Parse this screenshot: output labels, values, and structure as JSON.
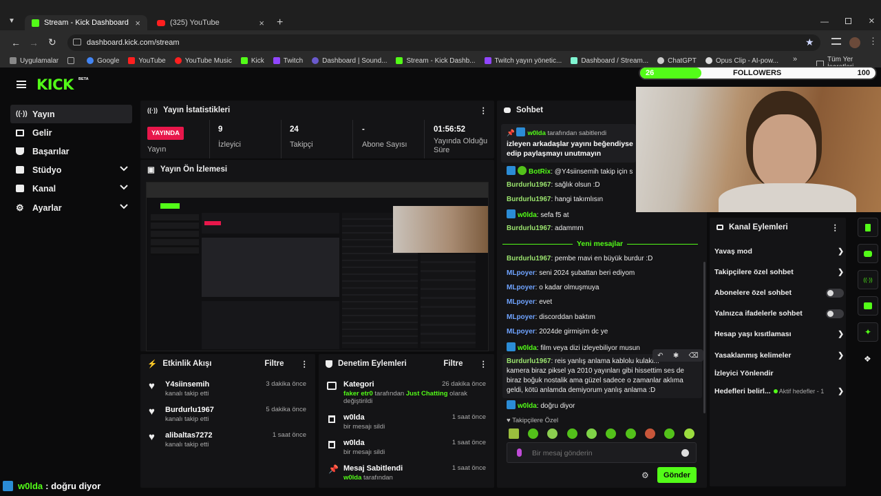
{
  "browser": {
    "tabs": [
      {
        "title": "Stream - Kick Dashboard",
        "active": true
      },
      {
        "title": "(325) YouTube",
        "active": false
      }
    ],
    "url": "dashboard.kick.com/stream",
    "bookmarks": [
      "Uygulamalar",
      "Google",
      "YouTube",
      "YouTube Music",
      "Kick",
      "Twitch",
      "Dashboard | Sound...",
      "Stream - Kick Dashb...",
      "Twitch yayın yönetic...",
      "Dashboard / Stream...",
      "ChatGPT",
      "Opus Clip - AI-pow..."
    ],
    "all_bookmarks": "Tüm Yer İşaretleri"
  },
  "brand": {
    "logo": "KICK",
    "badge": "BETA"
  },
  "sidebar": {
    "items": [
      {
        "label": "Yayın",
        "icon": "broadcast-icon"
      },
      {
        "label": "Gelir",
        "icon": "revenue-icon"
      },
      {
        "label": "Başarılar",
        "icon": "trophy-icon"
      },
      {
        "label": "Stüdyo",
        "icon": "studio-icon"
      },
      {
        "label": "Kanal",
        "icon": "channel-icon"
      },
      {
        "label": "Ayarlar",
        "icon": "gear-icon"
      }
    ]
  },
  "stats": {
    "title": "Yayın İstatistikleri",
    "live_badge": "YAYINDA",
    "live_label": "Yayın",
    "viewers_value": "9",
    "viewers_label": "İzleyici",
    "followers_value": "24",
    "followers_label": "Takipçi",
    "subs_value": "-",
    "subs_label": "Abone Sayısı",
    "duration_value": "01:56:52",
    "duration_label": "Yayında Olduğu Süre"
  },
  "preview": {
    "title": "Yayın Ön İzlemesi"
  },
  "activity": {
    "title": "Etkinlik Akışı",
    "filter": "Filtre",
    "items": [
      {
        "name": "Y4siinsemih",
        "sub": "kanalı takip etti",
        "time": "3 dakika önce"
      },
      {
        "name": "Burdurlu1967",
        "sub": "kanalı takip etti",
        "time": "5 dakika önce"
      },
      {
        "name": "alibaltas7272",
        "sub": "kanalı takip etti",
        "time": "1 saat önce"
      }
    ]
  },
  "moderation": {
    "title": "Denetim Eylemleri",
    "filter": "Filtre",
    "category": {
      "title": "Kategori",
      "time": "26 dakika önce",
      "user": "faker etr0",
      "mid1": " tarafından ",
      "game": "Just Chatting",
      "mid2": " olarak",
      "end": "değiştirildi"
    },
    "items": [
      {
        "title": "w0lda",
        "sub": "bir mesajı sildi",
        "time": "1 saat önce"
      },
      {
        "title": "w0lda",
        "sub": "bir mesajı sildi",
        "time": "1 saat önce"
      },
      {
        "title": "Mesaj Sabitlendi",
        "sub_user": "w0lda",
        "sub": " tarafından",
        "time": "1 saat önce"
      }
    ]
  },
  "chat": {
    "title": "Sohbet",
    "pinned_by_user": "w0lda",
    "pinned_by_text": "tarafından sabitlendi",
    "pinned_text_1": "izleyen arkadaşlar yayını beğendiyse",
    "pinned_text_2": "edip paylaşmayı unutmayın",
    "new_messages": "Yeni mesajlar",
    "messages": [
      {
        "user": "BotRix",
        "text": ": @Y4siinsemih takip için s"
      },
      {
        "user": "Burdurlu1967",
        "text": ": sağlık olsun :D"
      },
      {
        "user": "Burdurlu1967",
        "text": ": hangi takımlısın"
      },
      {
        "user": "w0lda",
        "text": ": sefa f5 at"
      },
      {
        "user": "Burdurlu1967",
        "text": ": adammm"
      },
      {
        "user": "Burdurlu1967",
        "text": ": pembe mavi en büyük burdur :D"
      },
      {
        "user": "MLpoyer",
        "text": ": seni 2024 şubattan beri ediyom"
      },
      {
        "user": "MLpoyer",
        "text": ": o kadar olmuşmuya"
      },
      {
        "user": "MLpoyer",
        "text": ": evet"
      },
      {
        "user": "MLpoyer",
        "text": ": discorddan baktım"
      },
      {
        "user": "MLpoyer",
        "text": ": 2024de girmişim dc ye"
      },
      {
        "user": "w0lda",
        "text": ": film veya dizi izleyebiliyor musun"
      },
      {
        "user": "Burdurlu1967",
        "text": ": reis yanlış anlama kablolu kulakl..."
      },
      {
        "user": "w0lda",
        "text": ": doğru diyor"
      }
    ],
    "long_msg_2": "kamera biraz piksel ya 2010 yayınları gibi hissettim ses de",
    "long_msg_3": "biraz boğuk nostalik ama güzel sadece o zamanlar aklıma",
    "long_msg_4": "geldi, kötü anlamda demiyorum yanlış anlama :D",
    "followers_only": "Takipçilere Özel",
    "input_placeholder": "Bir mesaj gönderin",
    "send": "Gönder"
  },
  "channel_actions": {
    "title": "Kanal Eylemleri",
    "items": [
      {
        "label": "Yavaş mod",
        "kind": "arrow"
      },
      {
        "label": "Takipçilere özel sohbet",
        "kind": "arrow"
      },
      {
        "label": "Abonelere özel sohbet",
        "kind": "toggle"
      },
      {
        "label": "Yalnızca ifadelerle sohbet",
        "kind": "toggle"
      },
      {
        "label": "Hesap yaşı kısıtlaması",
        "kind": "arrow"
      },
      {
        "label": "Yasaklanmış kelimeler",
        "kind": "arrow"
      },
      {
        "label": "İzleyici Yönlendir",
        "kind": "none"
      },
      {
        "label": "Hedefleri belirl...",
        "kind": "arrow"
      }
    ],
    "goals_status": "Aktif hedefler - 1"
  },
  "overlay": {
    "goal_current": "26",
    "goal_label": "FOLLOWERS",
    "goal_target": "100",
    "goal_progress": 0.26,
    "bottom_user": "w0lda",
    "bottom_text": " : doğru diyor"
  },
  "colors": {
    "accent": "#53fc18",
    "live": "#e8174b",
    "bg": "#0b0b0c",
    "panel": "#141416"
  }
}
